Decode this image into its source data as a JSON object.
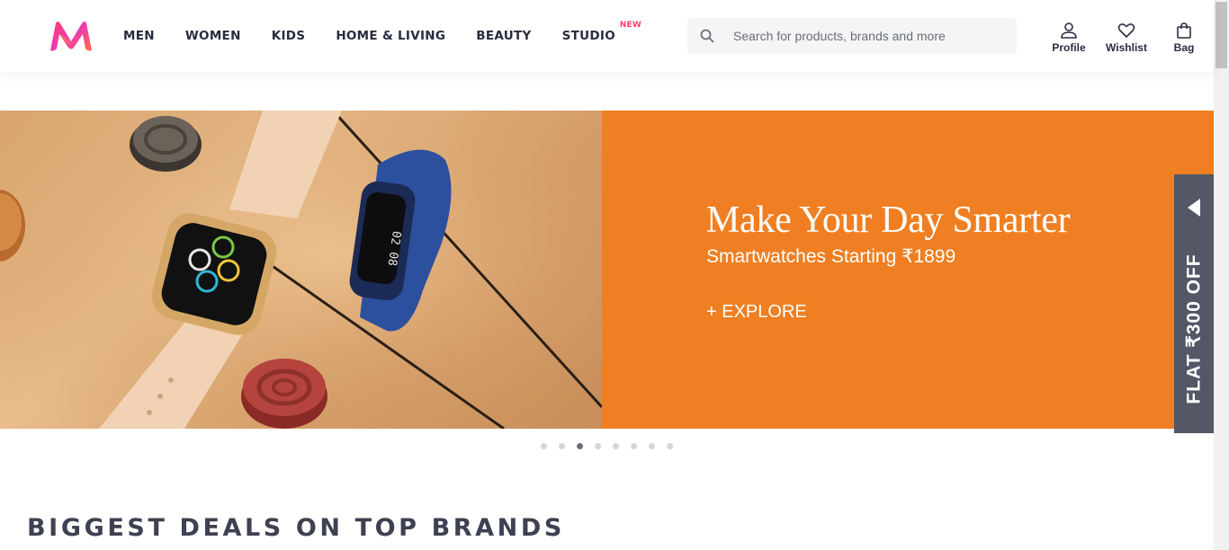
{
  "header": {
    "logo_name": "myntra-logo",
    "nav": [
      {
        "label": "MEN"
      },
      {
        "label": "WOMEN"
      },
      {
        "label": "KIDS"
      },
      {
        "label": "HOME & LIVING"
      },
      {
        "label": "BEAUTY"
      },
      {
        "label": "STUDIO",
        "badge": "NEW"
      }
    ],
    "search": {
      "placeholder": "Search for products, brands and more",
      "value": ""
    },
    "actions": [
      {
        "label": "Profile",
        "icon": "user-icon"
      },
      {
        "label": "Wishlist",
        "icon": "heart-icon"
      },
      {
        "label": "Bag",
        "icon": "bag-icon"
      }
    ]
  },
  "banner": {
    "title": "Make Your Day Smarter",
    "subtitle": "Smartwatches Starting ₹1899",
    "cta": "+ EXPLORE",
    "panel_color": "#ef7f22"
  },
  "offer_tab": {
    "label": "FLAT ₹300 OFF",
    "color": "#535766"
  },
  "carousel": {
    "total": 8,
    "active_index": 2
  },
  "section": {
    "title": "BIGGEST DEALS ON TOP BRANDS"
  },
  "colors": {
    "accent": "#ff3f6c",
    "text": "#282c3f"
  }
}
